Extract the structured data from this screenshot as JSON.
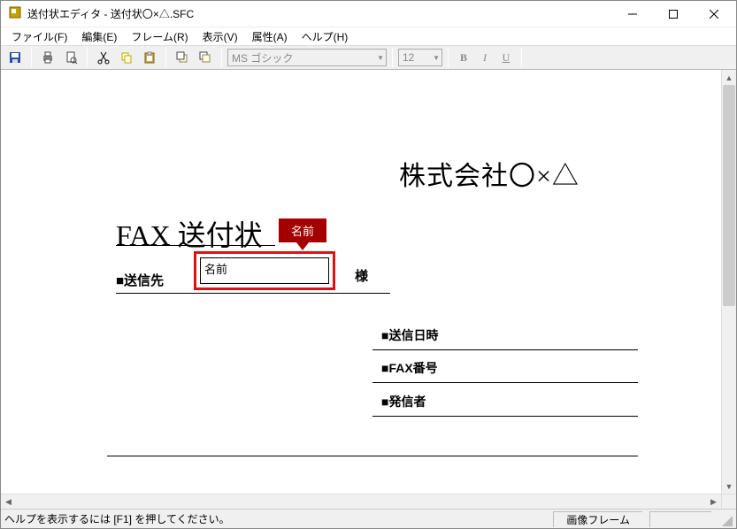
{
  "window": {
    "title": "送付状エディタ - 送付状〇×△.SFC"
  },
  "menus": {
    "file": "ファイル(F)",
    "edit": "編集(E)",
    "frame": "フレーム(R)",
    "view": "表示(V)",
    "attr": "属性(A)",
    "help": "ヘルプ(H)"
  },
  "toolbar": {
    "font_name": "MS ゴシック",
    "font_size": "12",
    "bold": "B",
    "italic": "I",
    "underline": "U"
  },
  "document": {
    "company": "株式会社〇×△",
    "fax_title": "FAX 送付状",
    "dest_label": "■送信先",
    "name_field_label": "名前",
    "sama": "様",
    "callout": "名前",
    "send_datetime_label": "■送信日時",
    "fax_number_label": "■FAX番号",
    "sender_label": "■発信者"
  },
  "status": {
    "hint": "ヘルプを表示するには [F1] を押してください。",
    "mode": "画像フレーム"
  }
}
